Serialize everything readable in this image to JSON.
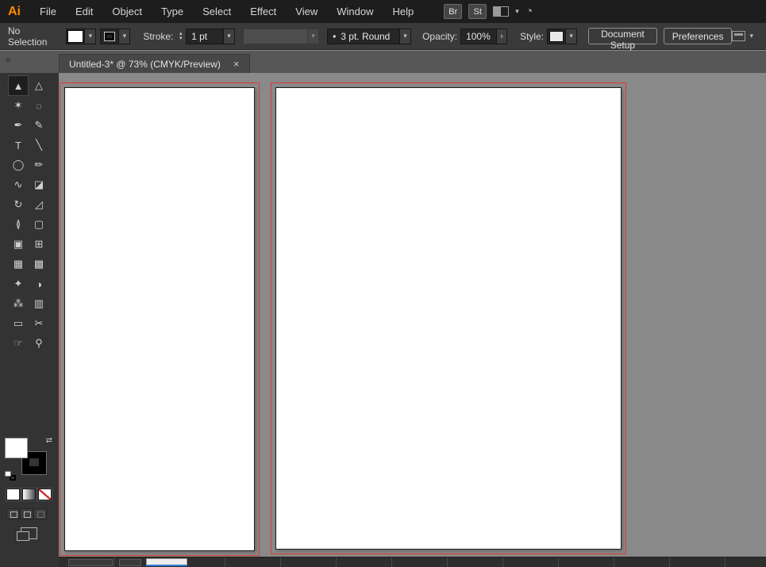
{
  "menubar": {
    "logo": "Ai",
    "items": [
      "File",
      "Edit",
      "Object",
      "Type",
      "Select",
      "Effect",
      "View",
      "Window",
      "Help"
    ],
    "bridge_badge": "Br",
    "stock_badge": "St"
  },
  "controlbar": {
    "selection_status": "No Selection",
    "stroke_label": "Stroke:",
    "stroke_weight": "1 pt",
    "profile_bullet": "•",
    "profile_value": "3 pt. Round",
    "opacity_label": "Opacity:",
    "opacity_value": "100%",
    "style_label": "Style:",
    "document_setup_label": "Document Setup",
    "preferences_label": "Preferences"
  },
  "tabbar": {
    "collapse_glyph": "«",
    "title": "Untitled-3* @ 73% (CMYK/Preview)",
    "close_glyph": "×"
  },
  "icons": {
    "chevron_down": "▾",
    "stepper_up": "▴",
    "stepper_down": "▾",
    "arrow_right": "›",
    "swap_arrows": "⇄",
    "gauge": "◔"
  },
  "toolbar": {
    "selected": "selection-tool",
    "tools": [
      {
        "name": "selection-tool",
        "glyph": "▲"
      },
      {
        "name": "direct-selection-tool",
        "glyph": "△"
      },
      {
        "name": "magic-wand-tool",
        "glyph": "✶"
      },
      {
        "name": "lasso-tool",
        "glyph": "◌"
      },
      {
        "name": "pen-tool",
        "glyph": "✒"
      },
      {
        "name": "curvature-tool",
        "glyph": "✎"
      },
      {
        "name": "type-tool",
        "glyph": "T"
      },
      {
        "name": "line-segment-tool",
        "glyph": "╲"
      },
      {
        "name": "ellipse-tool",
        "glyph": "◯"
      },
      {
        "name": "paintbrush-tool",
        "glyph": "✏"
      },
      {
        "name": "shaper-tool",
        "glyph": "∿"
      },
      {
        "name": "eraser-tool",
        "glyph": "◪"
      },
      {
        "name": "rotate-tool",
        "glyph": "↻"
      },
      {
        "name": "scale-tool",
        "glyph": "◿"
      },
      {
        "name": "width-tool",
        "glyph": "≬"
      },
      {
        "name": "free-transform-tool",
        "glyph": "▢"
      },
      {
        "name": "shape-builder-tool",
        "glyph": "▣"
      },
      {
        "name": "perspective-grid-tool",
        "glyph": "⊞"
      },
      {
        "name": "mesh-tool",
        "glyph": "▦"
      },
      {
        "name": "gradient-tool",
        "glyph": "▩"
      },
      {
        "name": "eyedropper-tool",
        "glyph": "✦"
      },
      {
        "name": "blend-tool",
        "glyph": "◑"
      },
      {
        "name": "symbol-sprayer-tool",
        "glyph": "⁂"
      },
      {
        "name": "column-graph-tool",
        "glyph": "▥"
      },
      {
        "name": "artboard-tool",
        "glyph": "▭"
      },
      {
        "name": "slice-tool",
        "glyph": "✂"
      },
      {
        "name": "hand-tool",
        "glyph": "☞"
      },
      {
        "name": "zoom-tool",
        "glyph": "⚲"
      }
    ]
  },
  "colors": {
    "accent_orange": "#ff8a00",
    "bleed_guide_red": "#dd3a3a",
    "scrollbar_accent_blue": "#2e7dd1"
  }
}
